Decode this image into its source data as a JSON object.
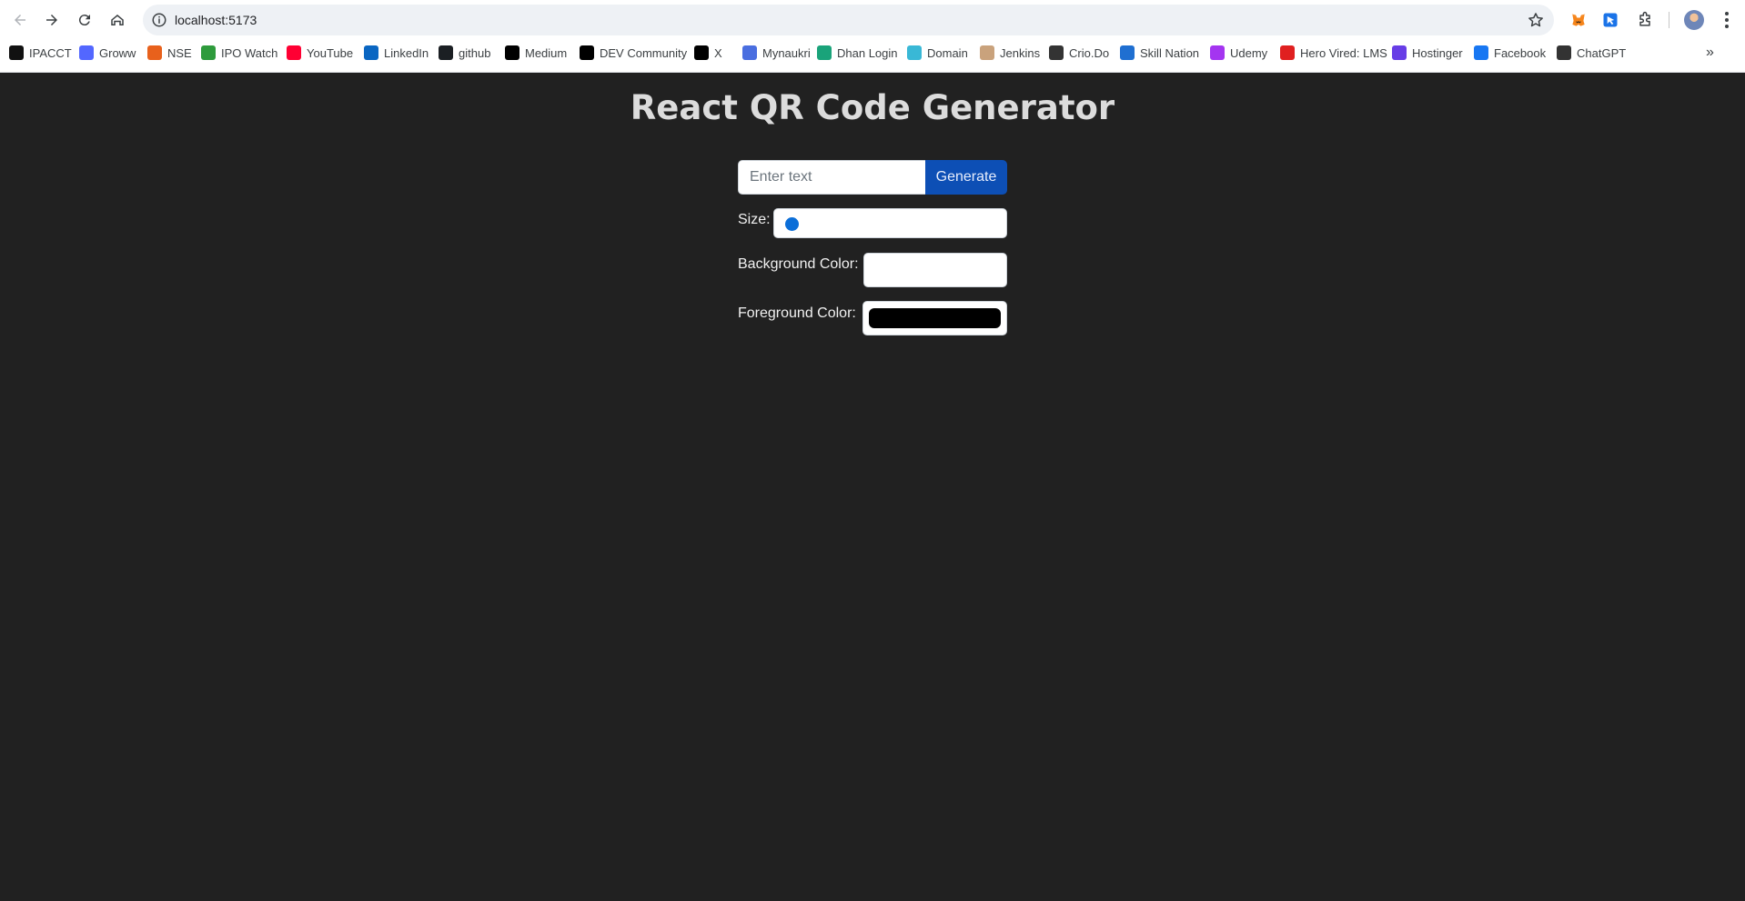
{
  "browser": {
    "url": "localhost:5173",
    "bookmarks": [
      {
        "label": "IPACCT",
        "icon": "ipacct-icon",
        "color": "#111111"
      },
      {
        "label": "Groww",
        "icon": "groww-icon",
        "color": "#5367ff"
      },
      {
        "label": "NSE",
        "icon": "nse-icon",
        "color": "#e8611c"
      },
      {
        "label": "IPO Watch",
        "icon": "ipo-watch-icon",
        "color": "#2e9b3c"
      },
      {
        "label": "YouTube",
        "icon": "youtube-icon",
        "color": "#ff0033"
      },
      {
        "label": "LinkedIn",
        "icon": "linkedin-icon",
        "color": "#0a66c2"
      },
      {
        "label": "github",
        "icon": "github-icon",
        "color": "#1b1f23"
      },
      {
        "label": "Medium",
        "icon": "medium-icon",
        "color": "#000000"
      },
      {
        "label": "DEV Community",
        "icon": "dev-icon",
        "color": "#000000"
      },
      {
        "label": "X",
        "icon": "x-icon",
        "color": "#000000"
      },
      {
        "label": "Mynaukri",
        "icon": "mynaukri-icon",
        "color": "#4a6ee0"
      },
      {
        "label": "Dhan Login",
        "icon": "dhan-icon",
        "color": "#1aa37a"
      },
      {
        "label": "Domain",
        "icon": "domain-icon",
        "color": "#39b8d6"
      },
      {
        "label": "Jenkins",
        "icon": "jenkins-icon",
        "color": "#c9a27c"
      },
      {
        "label": "Crio.Do",
        "icon": "crio-icon",
        "color": "#333333"
      },
      {
        "label": "Skill Nation",
        "icon": "skill-nation-icon",
        "color": "#1f6fd1"
      },
      {
        "label": "Udemy",
        "icon": "udemy-icon",
        "color": "#a435f0"
      },
      {
        "label": "Hero Vired: LMS",
        "icon": "hero-vired-icon",
        "color": "#e02020"
      },
      {
        "label": "Hostinger",
        "icon": "hostinger-icon",
        "color": "#673de6"
      },
      {
        "label": "Facebook",
        "icon": "facebook-icon",
        "color": "#1877f2"
      },
      {
        "label": "ChatGPT",
        "icon": "chatgpt-icon",
        "color": "#333333"
      }
    ]
  },
  "app": {
    "title": "React QR Code Generator",
    "text_placeholder": "Enter text",
    "text_value": "",
    "generate_label": "Generate",
    "size_label": "Size:",
    "size_value": 0,
    "bg_label": "Background Color:",
    "bg_color": "#ffffff",
    "fg_label": "Foreground Color:",
    "fg_color": "#000000",
    "accent_color": "#0d4fb5"
  }
}
